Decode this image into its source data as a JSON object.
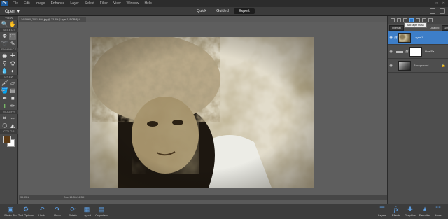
{
  "menubar": {
    "logo": "Pe",
    "items": [
      "File",
      "Edit",
      "Image",
      "Enhance",
      "Layer",
      "Select",
      "Filter",
      "View",
      "Window",
      "Help"
    ],
    "window_controls": [
      "—",
      "□",
      "✕"
    ]
  },
  "modebar": {
    "open_label": "Open",
    "modes": [
      "Quick",
      "Guided",
      "Expert"
    ],
    "active_mode": "Expert"
  },
  "tools": {
    "sections": [
      "VIEW",
      "SELECT",
      "ENHANCE",
      "DRAW",
      "MODIFY",
      "COLOR"
    ],
    "foreground_color": "#5b3a16",
    "background_color": "#ffffff"
  },
  "document": {
    "tab_title": "1415960_20011694.jpg @ 33.3% (Layer 1, RGB/8) *",
    "zoom": "33.33%",
    "doc_info": "Doc: 16.0M/44.3M"
  },
  "panels": {
    "blend_mode": "Overlay",
    "tooltip": "Add layer mask",
    "opacity_label": "Opacity:",
    "opacity_value": "100%",
    "layers": [
      {
        "name": "Layer 1",
        "active": true
      },
      {
        "name": "Hue/Sa...",
        "active": false
      },
      {
        "name": "Background",
        "active": false
      }
    ]
  },
  "bottombar": {
    "left": [
      "Photo Bin",
      "Tool Options",
      "Undo",
      "Redo",
      "Rotate",
      "Layout",
      "Organizer"
    ],
    "right": [
      "Layers",
      "Effects",
      "Graphics",
      "Favorites",
      "More"
    ]
  },
  "colors": {
    "accent": "#3d7ec8",
    "active_mode_bg": "#1e1e1e"
  }
}
